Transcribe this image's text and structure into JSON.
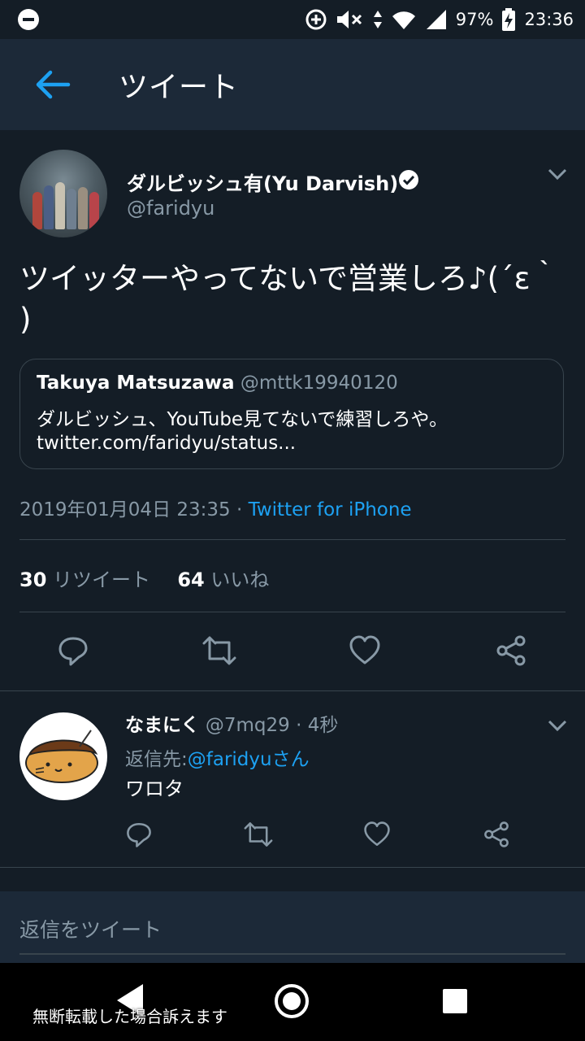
{
  "status_bar": {
    "battery": "97%",
    "time": "23:36"
  },
  "app_bar": {
    "title": "ツイート"
  },
  "tweet": {
    "author_name": "ダルビッシュ有(Yu Darvish)",
    "author_handle": "@faridyu",
    "text": "ツイッターやってないで営業しろ♪(´ε｀ )",
    "quote": {
      "name": "Takuya Matsuzawa",
      "handle": "@mttk19940120",
      "body": "ダルビッシュ、YouTube見てないで練習しろや。",
      "link": "twitter.com/faridyu/status..."
    },
    "timestamp": "2019年01月04日 23:35",
    "separator": "·",
    "source": "Twitter for iPhone",
    "retweets_count": "30",
    "retweets_label": "リツイート",
    "likes_count": "64",
    "likes_label": "いいね"
  },
  "reply": {
    "name": "なまにく",
    "handle": "@7mq29",
    "time": "· 4秒",
    "reply_to_label": "返信先:",
    "reply_to_mention": "@faridyuさん",
    "text": "ワロタ"
  },
  "composer": {
    "placeholder": "返信をツイート"
  },
  "overlay": {
    "watermark": "無断転載した場合訴えます"
  },
  "colors": {
    "background": "#141d26",
    "bar": "#1c2938",
    "accent": "#1da1f2",
    "muted": "#8899a6",
    "divider": "#38444d"
  },
  "icons": [
    "back-arrow-icon",
    "verified-badge-icon",
    "chevron-down-icon",
    "reply-icon",
    "retweet-icon",
    "like-icon",
    "share-icon"
  ]
}
